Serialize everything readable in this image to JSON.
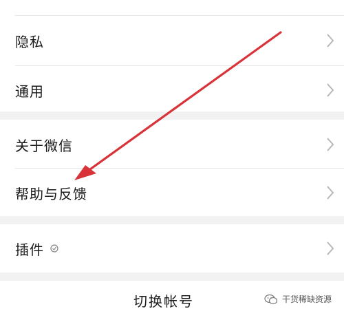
{
  "settings": {
    "items": [
      {
        "label": "隐私"
      },
      {
        "label": "通用"
      },
      {
        "label": "关于微信"
      },
      {
        "label": "帮助与反馈"
      },
      {
        "label": "插件"
      }
    ]
  },
  "footer": {
    "switch_account_label": "切换帐号"
  },
  "watermark": {
    "text": "干货稀缺资源"
  },
  "colors": {
    "arrow": "#d9333a",
    "background": "#f2f2f2",
    "panel": "#ffffff"
  }
}
